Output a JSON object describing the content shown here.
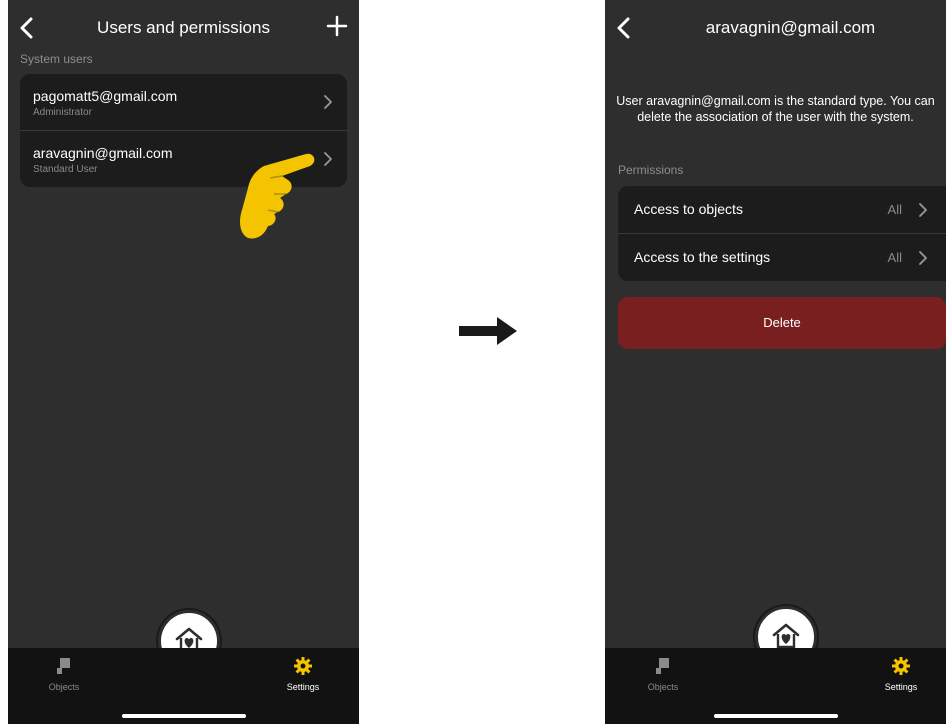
{
  "left_screen": {
    "title": "Users and permissions",
    "section_label": "System users",
    "users": [
      {
        "email": "pagomatt5@gmail.com",
        "role": "Administrator"
      },
      {
        "email": "aravagnin@gmail.com",
        "role": "Standard User"
      }
    ],
    "icons": {
      "back": "chevron-left-icon",
      "add": "plus-icon",
      "pointer": "pointing-hand-icon"
    }
  },
  "right_screen": {
    "title": "aravagnin@gmail.com",
    "description": "User aravagnin@gmail.com is the standard type. You can delete the association of the user with the system.",
    "section_label": "Permissions",
    "permissions": [
      {
        "label": "Access to objects",
        "value": "All"
      },
      {
        "label": "Access to the settings",
        "value": "All"
      }
    ],
    "delete_label": "Delete"
  },
  "tabbar": {
    "objects_label": "Objects",
    "settings_label": "Settings"
  },
  "colors": {
    "background": "#2e2e2e",
    "card": "#1c1c1c",
    "delete": "#7a1f1f",
    "accent": "#f5c400"
  }
}
